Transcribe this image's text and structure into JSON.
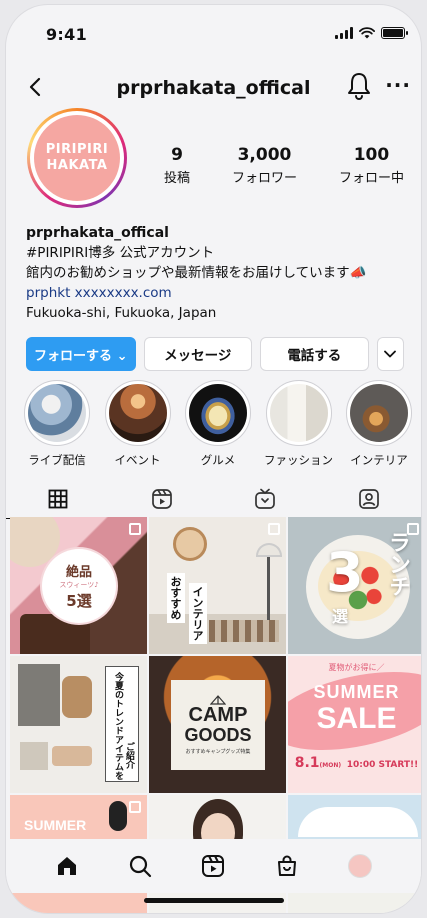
{
  "status_bar": {
    "time": "9:41"
  },
  "header": {
    "username": "prprhakata_offical"
  },
  "profile": {
    "logo_line1": "PIRIPIRI",
    "logo_line2": "HAKATA",
    "stats": [
      {
        "value": "9",
        "label": "投稿"
      },
      {
        "value": "3,000",
        "label": "フォロワー"
      },
      {
        "value": "100",
        "label": "フォロー中"
      }
    ]
  },
  "bio": {
    "name": "prprhakata_offical",
    "line1": "#PIRIPIRI博多 公式アカウント",
    "line2": "館内のお勧めショップや最新情報をお届けしています📣",
    "link": "prphkt xxxxxxxx.com",
    "location": "Fukuoka-shi, Fukuoka, Japan"
  },
  "actions": {
    "follow": "フォローする ⌄",
    "message": "メッセージ",
    "call": "電話する"
  },
  "highlights": [
    {
      "label": "ライブ配信"
    },
    {
      "label": "イベント"
    },
    {
      "label": "グルメ"
    },
    {
      "label": "ファッション"
    },
    {
      "label": "インテリア"
    }
  ],
  "posts": {
    "sweets": {
      "line1": "絶品",
      "line2": "スウィーツ♪",
      "line3": "5選"
    },
    "interior": {
      "text1": "おすすめ",
      "text2": "インテリア"
    },
    "lunch": {
      "num": "3",
      "text1": "ランチ",
      "text2": "選"
    },
    "fashion": {
      "text1": "今夏のトレンドアイテムを",
      "text2": "ご紹介"
    },
    "camp": {
      "title1": "CAMP",
      "title2": "GOODS",
      "sub": "おすすめキャンプグッズ特集"
    },
    "sale": {
      "pre": "夏物がお得に／",
      "title1": "SUMMER",
      "title2": "SALE",
      "date": "8.1",
      "day": "(MON)",
      "time": "10:00 START!!"
    },
    "summer": {
      "title": "SUMMER"
    }
  },
  "colors": {
    "accent": "#2e9cf2",
    "logo_pink": "#f5a7a2",
    "sale_pink": "#f26d84"
  }
}
